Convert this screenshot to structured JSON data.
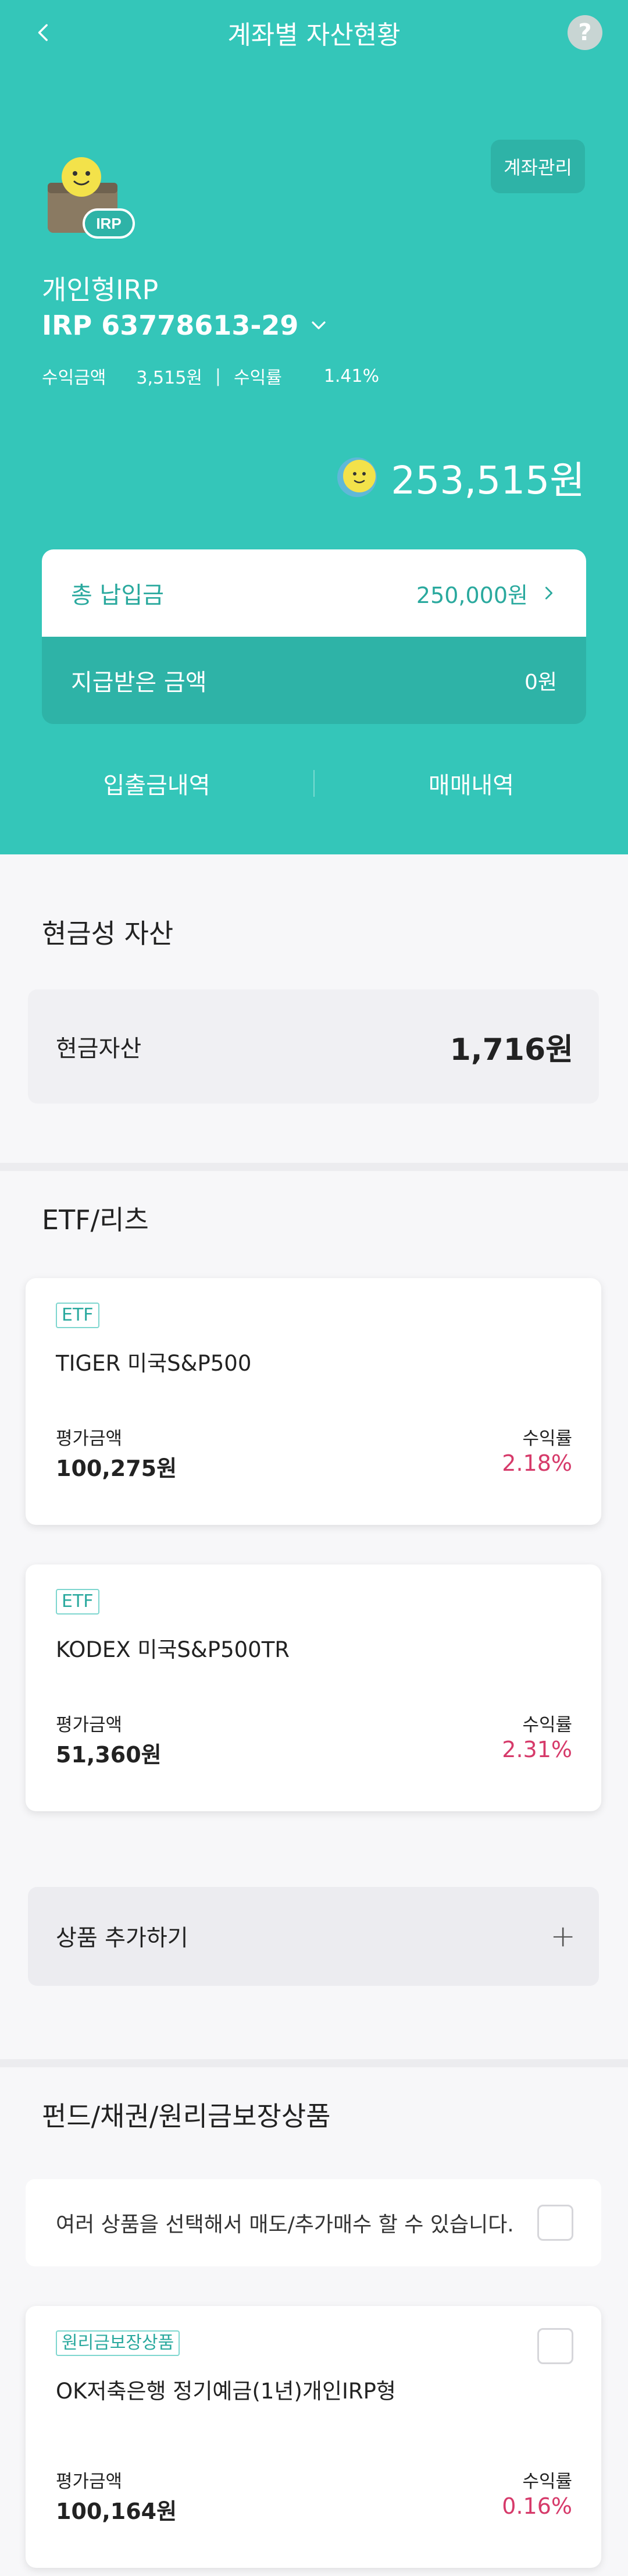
{
  "header": {
    "title": "계좌별 자산현황",
    "help": "?"
  },
  "account": {
    "manage_label": "계좌관리",
    "type": "개인형IRP",
    "number": "IRP 63778613-29",
    "profit_label": "수익금액",
    "profit_value": "3,515원",
    "separator": "|",
    "rate_label": "수익률",
    "rate_value": "1.41%",
    "total": "253,515원",
    "wallet_badge": "IRP"
  },
  "payments": {
    "total_paid_label": "총 납입금",
    "total_paid_value": "250,000원",
    "received_label": "지급받은 금액",
    "received_value": "0원"
  },
  "links": {
    "deposits": "입출금내역",
    "trades": "매매내역"
  },
  "cash_section": {
    "title": "현금성 자산",
    "item_label": "현금자산",
    "item_value": "1,716원"
  },
  "etf_section": {
    "title": "ETF/리츠",
    "products": [
      {
        "badge": "ETF",
        "name": "TIGER 미국S&P500",
        "eval_label": "평가금액",
        "eval_value": "100,275원",
        "rate_label": "수익률",
        "rate_value": "2.18%"
      },
      {
        "badge": "ETF",
        "name": "KODEX 미국S&P500TR",
        "eval_label": "평가금액",
        "eval_value": "51,360원",
        "rate_label": "수익률",
        "rate_value": "2.31%"
      }
    ],
    "add_label": "상품 추가하기",
    "add_symbol": "+"
  },
  "fund_section": {
    "title": "펀드/채권/원리금보장상품",
    "select_text": "여러 상품을 선택해서 매도/추가매수 할 수 있습니다.",
    "products": [
      {
        "badge": "원리금보장상품",
        "name": "OK저축은행 정기예금(1년)개인IRP형",
        "eval_label": "평가금액",
        "eval_value": "100,164원",
        "rate_label": "수익률",
        "rate_value": "0.16%"
      }
    ]
  },
  "colors": {
    "brand": "#34c6b9",
    "brand_dark": "#2eb3a7",
    "positive": "#d63a6a"
  },
  "icons": [
    "back-arrow-icon",
    "help-icon",
    "wallet-icon",
    "chevron-down-icon",
    "coin-icon",
    "chevron-right-icon",
    "plus-icon",
    "checkbox-icon"
  ]
}
